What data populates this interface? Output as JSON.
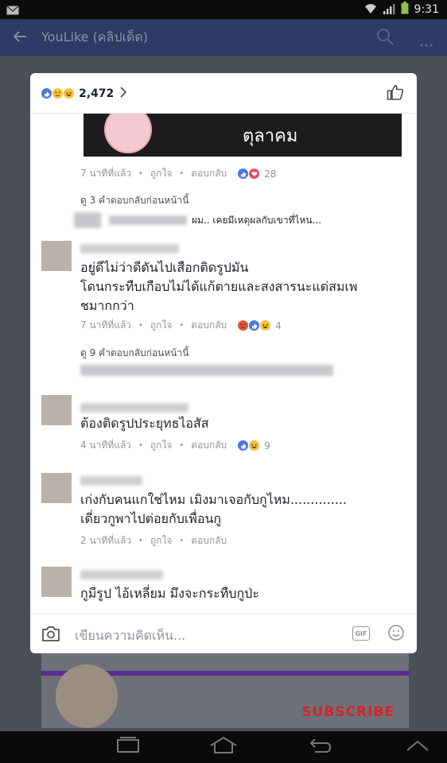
{
  "status_bar": {
    "time": "9:31",
    "icons": [
      "mail-icon",
      "wifi-icon",
      "signal-icon",
      "battery-icon"
    ]
  },
  "app_bar": {
    "title": "YouLike (คลิปเด็ด)",
    "icons": [
      "back-arrow-icon",
      "search-icon",
      "more-icon"
    ]
  },
  "background": {
    "subscribe_label": "SUBSCRIBE",
    "accent": "#d42424"
  },
  "modal": {
    "reaction_count": "2,472",
    "reaction_icons": [
      "like-icon",
      "sad-icon",
      "haha-icon"
    ],
    "sticker_text": "ตุลาคม",
    "actions": {
      "like": "ถูกใจ",
      "reply": "ตอบกลับ"
    },
    "comments": [
      {
        "time": "7 นาทีที่แล้ว",
        "reaction_count": "28",
        "view_previous": "ดู 3 คำตอบกลับก่อนหน้านี้",
        "reply_preview": "ผม.. เคยมีเหตุผลกับเขาที่ไหน..."
      },
      {
        "lines": [
          "อยู่ดีไม่ว่าดีดันไปเสือกติดรูปมัน",
          "โดนกระทืบเกือบไม่ได้แก้ตายและสงสารนะแต่สมเพ",
          "ชมากกว่า"
        ],
        "time": "7 นาทีที่แล้ว",
        "reaction_count": "4",
        "view_previous": "ดู 9 คำตอบกลับก่อนหน้านี้"
      },
      {
        "lines": [
          "ต้องติดรูปประยุทธไอสัส"
        ],
        "time": "4 นาทีที่แล้ว",
        "reaction_count": "9"
      },
      {
        "lines": [
          "เก่งกับคนแกใช่ไหม เมิงมาเจอกับกูไหม..............",
          "เดี่ยวกูพาไปต่อยกับเพื่อนกู"
        ],
        "time": "2 นาทีที่แล้ว"
      },
      {
        "lines": [
          "กูมีรูป ไอ้เหลี่ยม มึงจะกระทืบกูป่ะ"
        ]
      }
    ],
    "composer": {
      "placeholder": "เขียนความคิดเห็น...",
      "gif_label": "GIF"
    }
  },
  "colors": {
    "fb_blue": "#4267b2",
    "app_bar": "#2b3b63",
    "text": "#1d2129",
    "meta": "#90949c"
  }
}
